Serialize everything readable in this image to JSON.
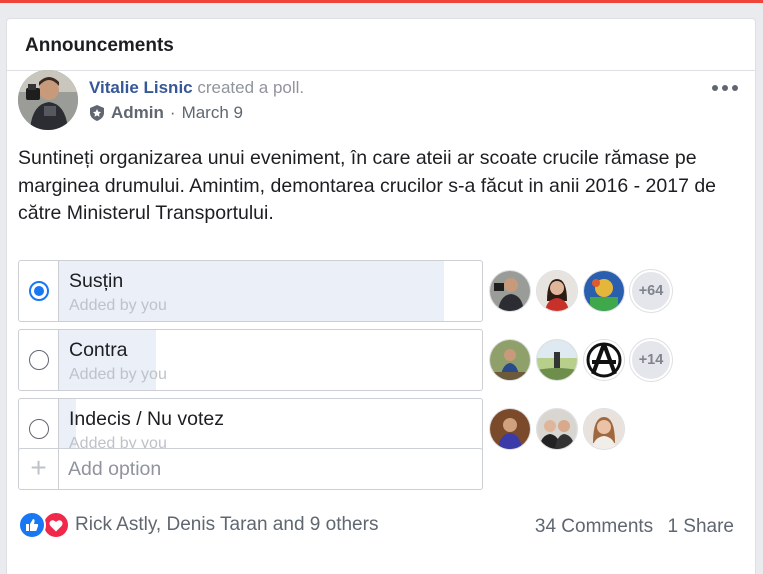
{
  "card": {
    "title": "Announcements"
  },
  "post": {
    "author": "Vitalie Lisnic",
    "action": "created a poll.",
    "role": "Admin",
    "separator": "·",
    "date": "March 9",
    "text": "Suntineți organizarea unui eveniment, în care ateii ar scoate crucile rămase pe marginea drumului. Amintim, demontarea crucilor s-a făcut in anii 2016 - 2017 de către Ministerul Transportului."
  },
  "poll": {
    "options": [
      {
        "label": "Susțin",
        "added_by": "Added by you",
        "selected": true,
        "share": 0.91,
        "extra_voters": "+64"
      },
      {
        "label": "Contra",
        "added_by": "Added by you",
        "selected": false,
        "share": 0.23,
        "extra_voters": "+14"
      },
      {
        "label": "Indecis / Nu votez",
        "added_by": "Added by you",
        "selected": false,
        "share": 0.04,
        "extra_voters": ""
      }
    ],
    "add_option_placeholder": "Add option"
  },
  "footer": {
    "reaction_names": "Rick Astly, Denis Taran and 9 others",
    "comments": "34 Comments",
    "shares": "1 Share"
  },
  "colors": {
    "link": "#365899",
    "accent": "#1877f2",
    "like": "#1877f2",
    "love": "#f0284a",
    "vote_fill": "#ebeff7",
    "top_bar": "#f0453a"
  },
  "icons": [
    "admin-shield-icon",
    "more-options-icon",
    "radio-icon",
    "plus-icon",
    "like-icon",
    "love-icon"
  ]
}
